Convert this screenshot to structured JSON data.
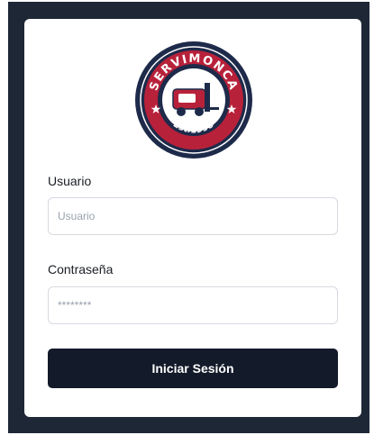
{
  "brand": {
    "name": "SERVIMONCA",
    "established": "Est.1998",
    "colors": {
      "navy": "#1e2a4a",
      "red": "#b8213a",
      "ring": "#ffffff"
    },
    "icon": "forklift-icon"
  },
  "form": {
    "username": {
      "label": "Usuario",
      "placeholder": "Usuario",
      "value": ""
    },
    "password": {
      "label": "Contraseña",
      "placeholder": "********",
      "value": ""
    },
    "submit_label": "Iniciar Sesión"
  },
  "theme": {
    "background": "#1e2736",
    "card": "#ffffff",
    "button": "#131a2a"
  }
}
